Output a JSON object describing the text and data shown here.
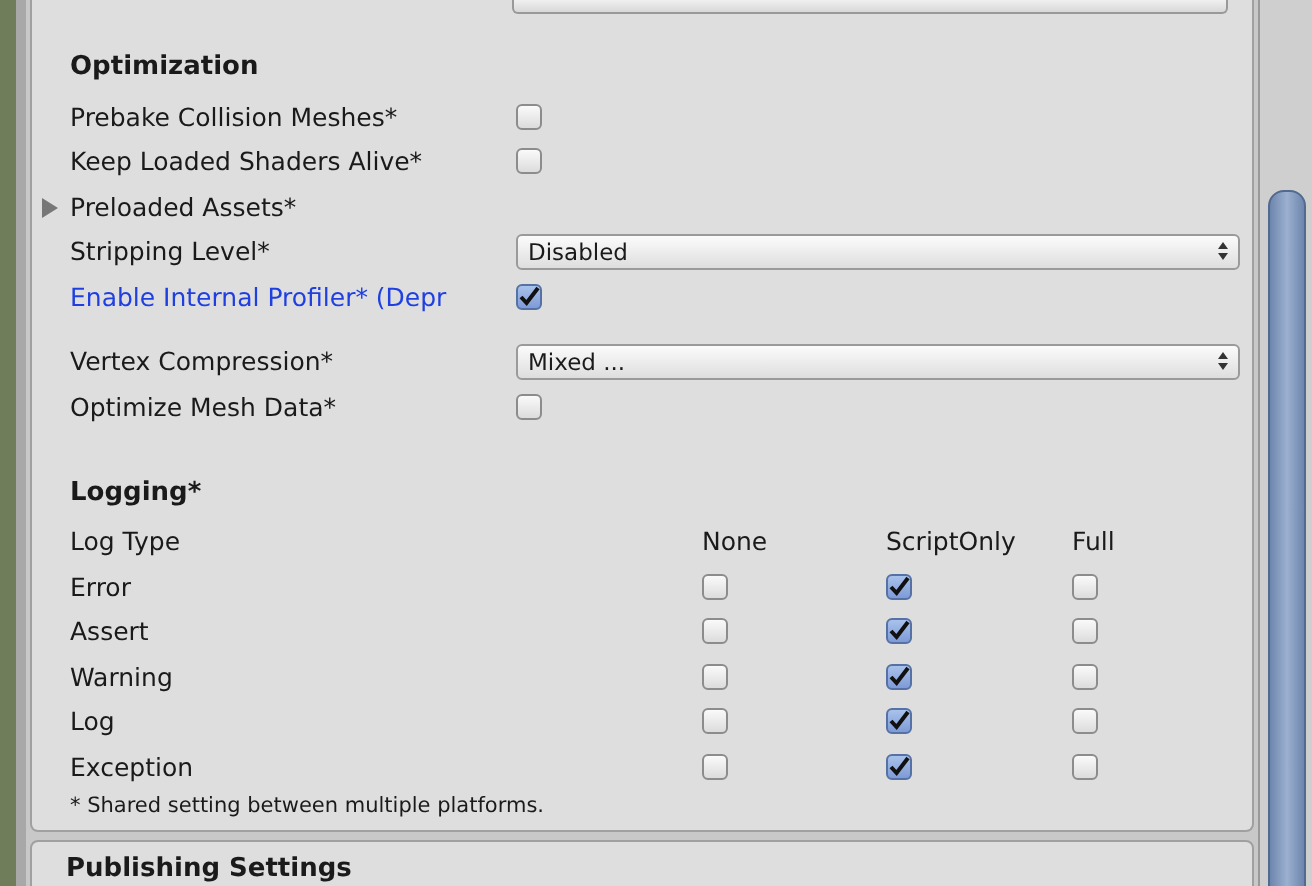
{
  "optimization": {
    "title": "Optimization",
    "groups": [
      [
        {
          "kind": "checkbox",
          "label": "Prebake Collision Meshes*",
          "checked": false,
          "highlighted": false
        },
        {
          "kind": "checkbox",
          "label": "Keep Loaded Shaders Alive*",
          "checked": false,
          "highlighted": false
        },
        {
          "kind": "foldout",
          "label": "Preloaded Assets*",
          "expanded": false
        },
        {
          "kind": "dropdown",
          "label": "Stripping Level*",
          "value": "Disabled"
        },
        {
          "kind": "checkbox",
          "label": "Enable Internal Profiler* (Depr",
          "checked": true,
          "highlighted": true
        }
      ],
      [
        {
          "kind": "dropdown",
          "label": "Vertex Compression*",
          "value": "Mixed ..."
        },
        {
          "kind": "checkbox",
          "label": "Optimize Mesh Data*",
          "checked": false,
          "highlighted": false
        }
      ]
    ]
  },
  "logging": {
    "title": "Logging*",
    "header": "Log Type",
    "columns": [
      "None",
      "ScriptOnly",
      "Full"
    ],
    "rows": [
      {
        "label": "Error",
        "options": [
          {
            "checked": false
          },
          {
            "checked": true
          },
          {
            "checked": false
          }
        ]
      },
      {
        "label": "Assert",
        "options": [
          {
            "checked": false
          },
          {
            "checked": true
          },
          {
            "checked": false
          }
        ]
      },
      {
        "label": "Warning",
        "options": [
          {
            "checked": false
          },
          {
            "checked": true
          },
          {
            "checked": false
          }
        ]
      },
      {
        "label": "Log",
        "options": [
          {
            "checked": false
          },
          {
            "checked": true
          },
          {
            "checked": false
          }
        ]
      },
      {
        "label": "Exception",
        "options": [
          {
            "checked": false
          },
          {
            "checked": true
          },
          {
            "checked": false
          }
        ]
      }
    ],
    "footnote": "* Shared setting between multiple platforms."
  },
  "publishing_settings": {
    "title": "Publishing Settings"
  }
}
